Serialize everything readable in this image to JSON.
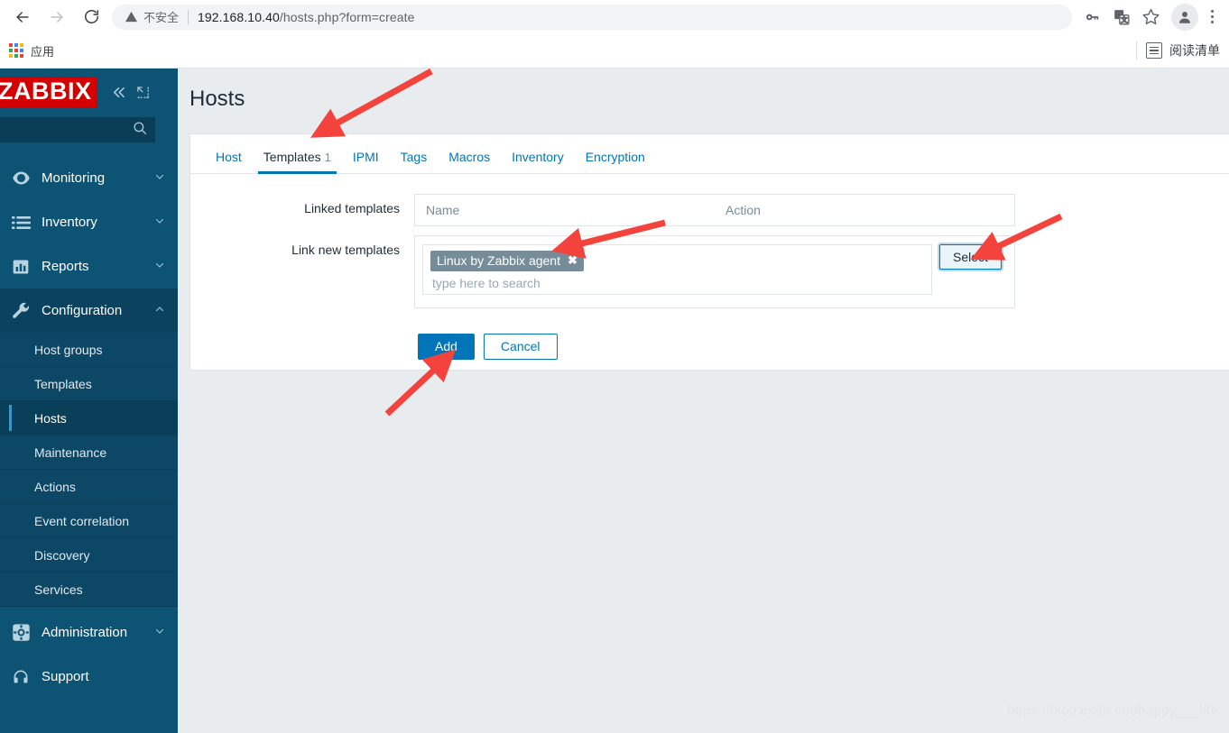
{
  "browser": {
    "back_icon": "arrow-left-icon",
    "forward_icon": "arrow-right-icon",
    "reload_icon": "reload-icon",
    "security_label": "不安全",
    "url": "192.168.10.40/hosts.php?form=create",
    "url_host": "192.168.10.40",
    "url_path": "/hosts.php?form=create",
    "toolbar_icons": [
      "password-key-icon",
      "translate-icon",
      "bookmark-star-icon",
      "profile-avatar-icon",
      "kebab-menu-icon"
    ],
    "bookmarks": {
      "apps_label": "应用",
      "apps_icon": "apps-grid-icon",
      "reading_list_label": "阅读清单",
      "reading_list_icon": "reading-list-icon"
    }
  },
  "sidebar": {
    "logo_text": "ZABBIX",
    "logo_bg": "#d40000",
    "collapse_icon": "chevron-double-left-icon",
    "expand_icon": "expand-corner-icon",
    "search_icon": "search-icon",
    "search_value": "",
    "nav": [
      {
        "label": "Monitoring",
        "icon": "eye-icon",
        "chevron": "chevron-down-icon",
        "expanded": false
      },
      {
        "label": "Inventory",
        "icon": "list-icon",
        "chevron": "chevron-down-icon",
        "expanded": false
      },
      {
        "label": "Reports",
        "icon": "bar-chart-icon",
        "chevron": "chevron-down-icon",
        "expanded": false
      },
      {
        "label": "Configuration",
        "icon": "wrench-icon",
        "chevron": "chevron-up-icon",
        "expanded": true
      }
    ],
    "configuration_submenu": [
      {
        "label": "Host groups",
        "active": false
      },
      {
        "label": "Templates",
        "active": false
      },
      {
        "label": "Hosts",
        "active": true
      },
      {
        "label": "Maintenance",
        "active": false
      },
      {
        "label": "Actions",
        "active": false
      },
      {
        "label": "Event correlation",
        "active": false
      },
      {
        "label": "Discovery",
        "active": false
      },
      {
        "label": "Services",
        "active": false
      }
    ],
    "bottom_nav": [
      {
        "label": "Administration",
        "icon": "gear-icon",
        "chevron": "chevron-down-icon"
      },
      {
        "label": "Support",
        "icon": "headset-icon",
        "chevron": ""
      }
    ],
    "bg_color": "#0d5374"
  },
  "main": {
    "page_title": "Hosts",
    "tabs": [
      {
        "label": "Host",
        "count": "",
        "active": false
      },
      {
        "label": "Templates",
        "count": "1",
        "active": true
      },
      {
        "label": "IPMI",
        "count": "",
        "active": false
      },
      {
        "label": "Tags",
        "count": "",
        "active": false
      },
      {
        "label": "Macros",
        "count": "",
        "active": false
      },
      {
        "label": "Inventory",
        "count": "",
        "active": false
      },
      {
        "label": "Encryption",
        "count": "",
        "active": false
      }
    ],
    "form": {
      "linked_templates_label": "Linked templates",
      "linked_col_name": "Name",
      "linked_col_action": "Action",
      "link_new_label": "Link new templates",
      "chip_label": "Linux by Zabbix agent",
      "chip_remove_icon": "close-x-icon",
      "search_placeholder": "type here to search",
      "search_value": "",
      "select_button": "Select"
    },
    "buttons": {
      "add": "Add",
      "cancel": "Cancel"
    },
    "accent_color": "#0275b8",
    "watermark": "https://blog.csdn.net/happy___life"
  },
  "annotations": {
    "arrow_color": "#f4433c",
    "arrows": [
      {
        "name": "arrow-to-templates-tab",
        "target": "Templates tab"
      },
      {
        "name": "arrow-to-template-chip",
        "target": "Linux by Zabbix agent chip"
      },
      {
        "name": "arrow-to-select-button",
        "target": "Select button"
      },
      {
        "name": "arrow-to-add-button",
        "target": "Add button"
      }
    ]
  }
}
